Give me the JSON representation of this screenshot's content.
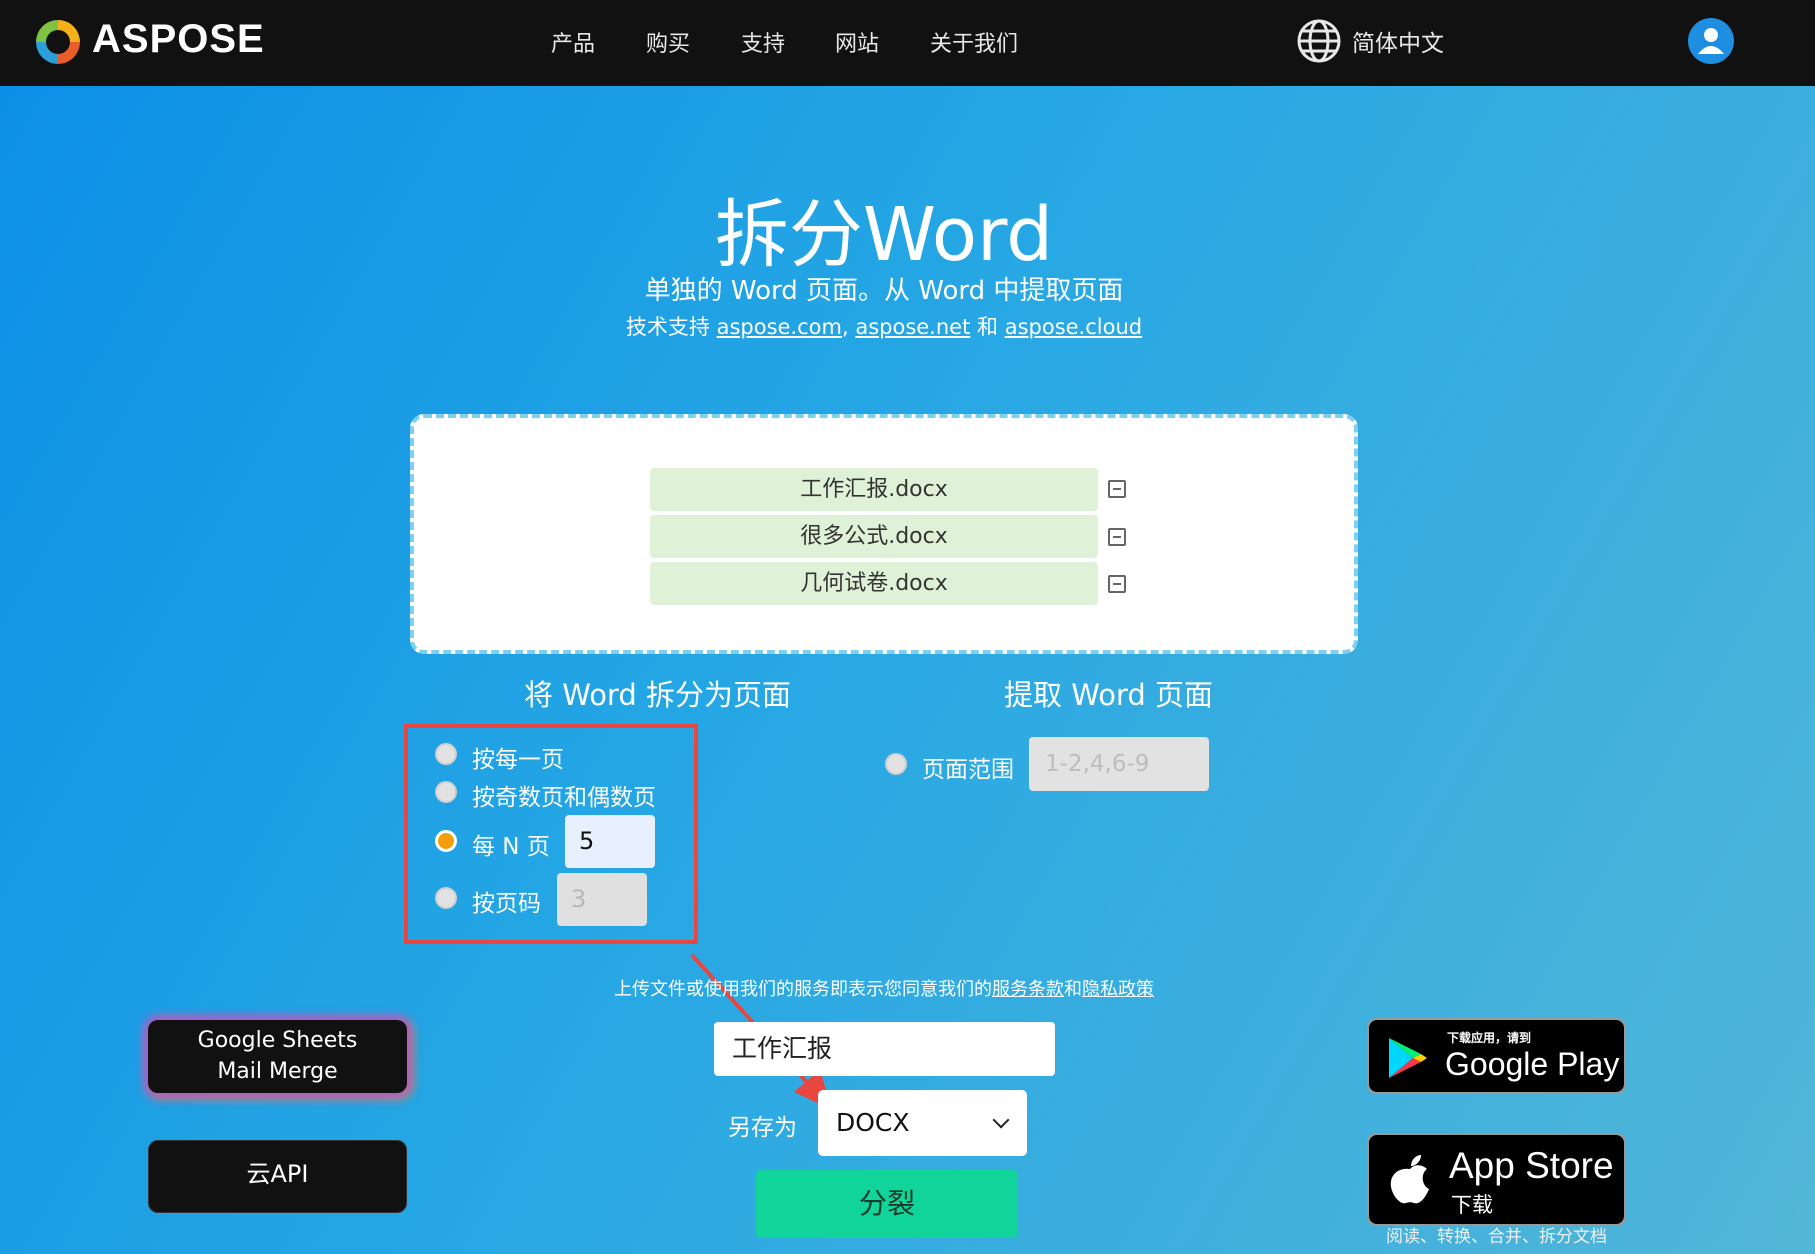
{
  "header": {
    "brand": "ASPOSE",
    "nav": [
      "产品",
      "购买",
      "支持",
      "网站",
      "关于我们"
    ],
    "language": "简体中文"
  },
  "hero": {
    "title": "拆分Word",
    "subtitle": "单独的 Word 页面。从 Word 中提取页面",
    "powered_prefix": "技术支持",
    "link1": "aspose.com",
    "sep1": ",",
    "link2": "aspose.net",
    "and": "和",
    "link3": "aspose.cloud"
  },
  "files": [
    "工作汇报.docx",
    "很多公式.docx",
    "几何试卷.docx"
  ],
  "split_section": {
    "title": "将 Word 拆分为页面",
    "options": [
      {
        "label": "按每一页",
        "selected": false
      },
      {
        "label": "按奇数页和偶数页",
        "selected": false
      },
      {
        "label": "每 N 页",
        "selected": true,
        "value": "5"
      },
      {
        "label": "按页码",
        "selected": false,
        "placeholder": "3"
      }
    ]
  },
  "extract_section": {
    "title": "提取 Word 页面",
    "option_label": "页面范围",
    "placeholder": "1-2,4,6-9"
  },
  "terms": {
    "prefix": "上传文件或使用我们的服务即表示您同意我们的",
    "tos": "服务条款",
    "and": "和",
    "privacy": "隐私政策"
  },
  "output": {
    "filename": "工作汇报",
    "save_as_label": "另存为",
    "format": "DOCX",
    "split_button": "分裂"
  },
  "side": {
    "google_sheets_line1": "Google Sheets",
    "google_sheets_line2": "Mail Merge",
    "cloud_api": "云API"
  },
  "stores": {
    "google_small": "下载应用，请到",
    "google_big": "Google Play",
    "apple_big": "App Store",
    "apple_small": "下载",
    "below_text": "阅读、转换、合并、拆分文档"
  },
  "colors": {
    "accent_radio": "#f59e0b",
    "split_button": "#10d49a",
    "annotation_red": "#e8463e",
    "file_row_bg": "#dff2d8"
  }
}
